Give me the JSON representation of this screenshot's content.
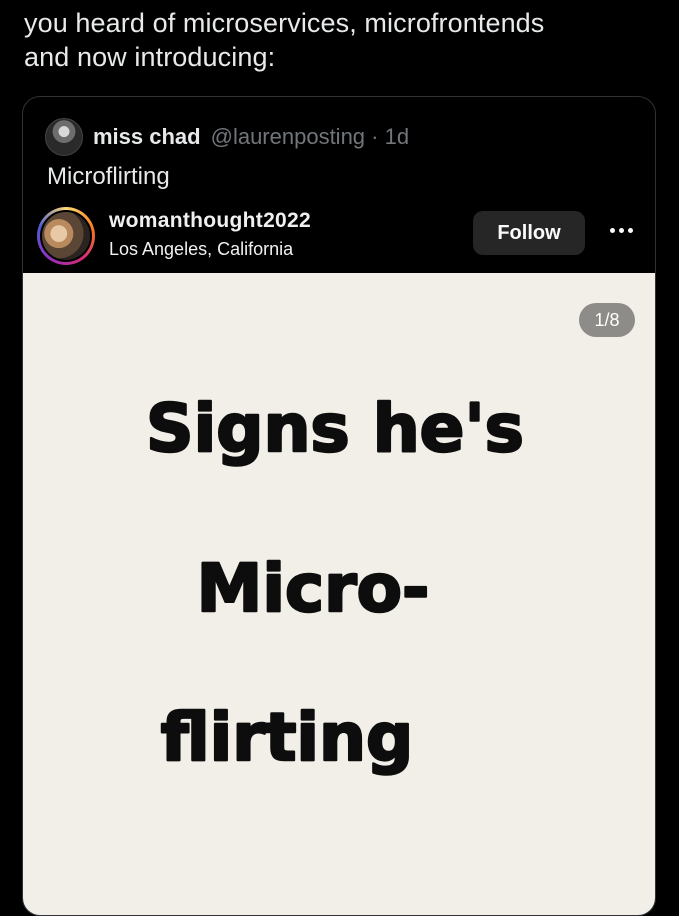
{
  "tweet": {
    "line1": "you heard of microservices, microfrontends",
    "line2": "and now introducing:"
  },
  "quote": {
    "display_name": "miss chad",
    "handle": "@laurenposting · 1d",
    "text": "Microflirting"
  },
  "instagram": {
    "username": "womanthought2022",
    "location": "Los Angeles, California",
    "follow_label": "Follow",
    "slide_counter": "1/8",
    "slide_lines": [
      "Signs he's",
      "Micro-",
      "flirting"
    ]
  },
  "icons": {
    "more": "more-horizontal-icon"
  }
}
